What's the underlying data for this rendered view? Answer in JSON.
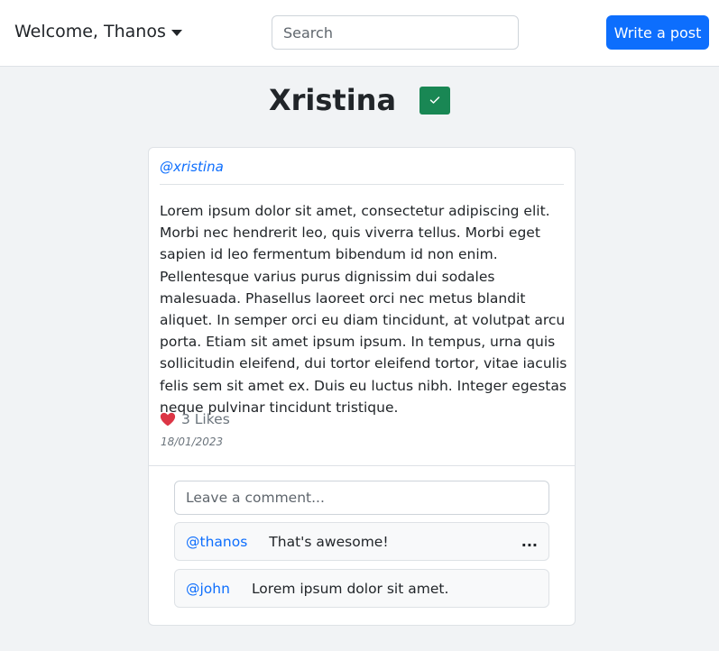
{
  "navbar": {
    "welcome": "Welcome, Thanos",
    "search_placeholder": "Search",
    "write_post_label": "Write a post"
  },
  "profile": {
    "name": "Xristina",
    "verified_icon": "check-icon",
    "verified_color": "#198754"
  },
  "post": {
    "author_handle": "@xristina",
    "body": "Lorem ipsum dolor sit amet, consectetur adipiscing elit. Morbi nec hendrerit leo, quis viverra tellus. Morbi eget sapien id leo fermentum bibendum id non enim. Pellentesque varius purus dignissim dui sodales malesuada. Phasellus laoreet orci nec metus blandit aliquet. In semper orci eu diam tincidunt, at volutpat arcu porta. Etiam sit amet ipsum ipsum. In tempus, urna quis sollicitudin eleifend, dui tortor eleifend tortor, vitae iaculis felis sem sit amet ex. Duis eu luctus nibh. Integer egestas neque pulvinar tincidunt tristique.",
    "likes_text": "3 Likes",
    "like_icon": "heart-icon",
    "like_color": "#dc3545",
    "date": "18/01/2023"
  },
  "comments": {
    "input_placeholder": "Leave a comment...",
    "items": [
      {
        "user": "@thanos",
        "text": "That's awesome!",
        "has_menu": true
      },
      {
        "user": "@john",
        "text": "Lorem ipsum dolor sit amet.",
        "has_menu": false
      }
    ],
    "menu_label": "..."
  },
  "colors": {
    "accent": "#0d6efd",
    "background": "#f1f3f5"
  }
}
